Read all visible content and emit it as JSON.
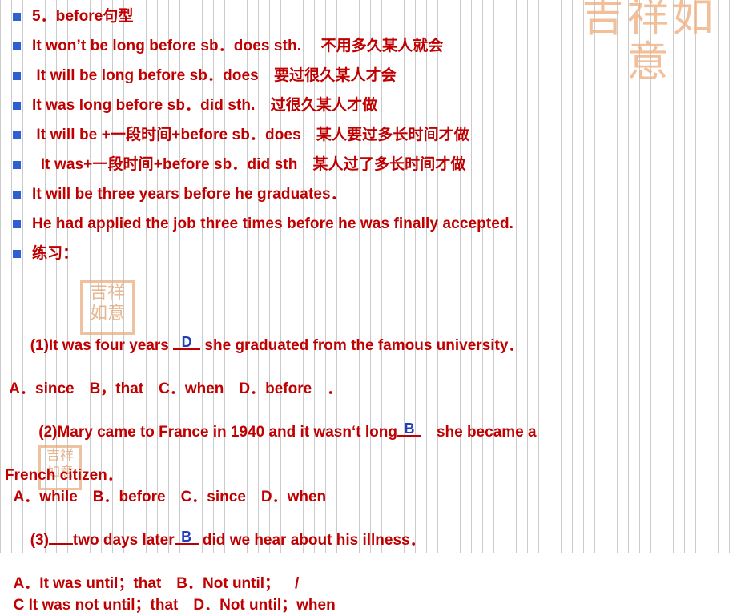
{
  "slide": {
    "bullets": [
      {
        "text": "5．before句型"
      },
      {
        "text": "It won’t be long before sb．does sth.  不用多久某人就会"
      },
      {
        "text": " It will be long before sb．does 要过很久某人才会"
      },
      {
        "text": "It was long before sb．did sth. 过很久某人才做"
      },
      {
        "text": " It will be +一段时间+before sb．does 某人要过多长时间才做"
      },
      {
        "text": "  It was+一段时间+before sb．did sth 某人过了多长时间才做"
      },
      {
        "text": "It will be three years before he graduates．"
      },
      {
        "text": "He had applied the job three times before he was finally accepted."
      },
      {
        "text": "练习："
      }
    ],
    "exercises": {
      "q1_stem_a": "(1)It was four years ",
      "q1_answer": "D",
      "q1_stem_b": " she graduated from the famous university．",
      "q1_options": " A．since B，that C．when D．before ．",
      "q2_stem_a": "  (2)Mary came to France in 1940 and it wasn‘t long",
      "q2_answer": "B",
      "q2_stem_b": " she became a",
      "q2_cont": "French citizen．",
      "q2_options": "  A．while B．before C．since D．when",
      "q3_stem_a": "(3)",
      "q3_answer_blank_label": "",
      "q3_stem_b": "two days later",
      "q3_answer": "B",
      "q3_stem_c": " did we hear about his illness．",
      "q3_options_a": "  A．It was until；that B．Not until； /",
      "q3_options_b": "  C It was not until；that D．Not until；when"
    },
    "decor": {
      "seal_large_text": "吉祥如意",
      "seal_mid_text": "吉祥如意",
      "seal_small_text": "吉祥如意"
    },
    "colors": {
      "text_red": "#c00000",
      "bullet_blue": "#2f5fd0",
      "answer_blue": "#1f3fbf",
      "seal_orange": "#e8a97a",
      "background": "#ffffff"
    }
  }
}
